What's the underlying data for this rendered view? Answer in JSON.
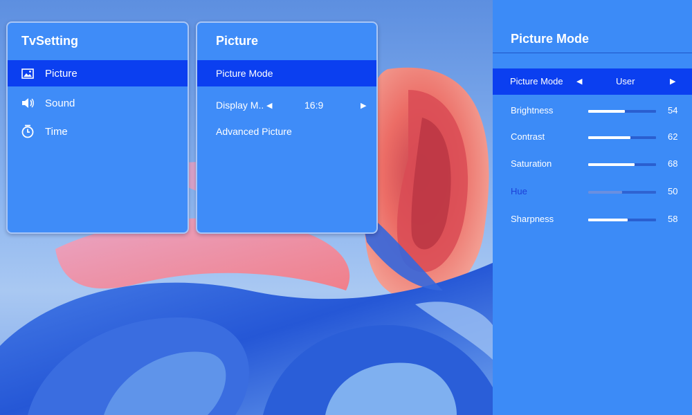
{
  "tv_setting": {
    "title": "TvSetting",
    "items": [
      {
        "label": "Picture",
        "icon": "image-icon",
        "selected": true
      },
      {
        "label": "Sound",
        "icon": "speaker-icon",
        "selected": false
      },
      {
        "label": "Time",
        "icon": "clock-icon",
        "selected": false
      }
    ]
  },
  "picture_menu": {
    "title": "Picture",
    "items": [
      {
        "label": "Picture Mode",
        "selected": true
      },
      {
        "label": "Display M..",
        "value": "16:9"
      },
      {
        "label": "Advanced Picture"
      }
    ]
  },
  "picture_mode_panel": {
    "title": "Picture Mode",
    "mode": {
      "label": "Picture Mode",
      "value": "User"
    },
    "sliders": [
      {
        "label": "Brightness",
        "value": 54,
        "display": "54"
      },
      {
        "label": "Contrast",
        "value": 62,
        "display": "62"
      },
      {
        "label": "Saturation",
        "value": 68,
        "display": "68"
      },
      {
        "label": "Hue",
        "value": 50,
        "display": "50",
        "disabled": true
      },
      {
        "label": "Sharpness",
        "value": 58,
        "display": "58"
      }
    ]
  },
  "colors": {
    "panel": "#3f8cf8",
    "selected": "#0b3ff0",
    "sidebar": "#3c8bf7"
  }
}
